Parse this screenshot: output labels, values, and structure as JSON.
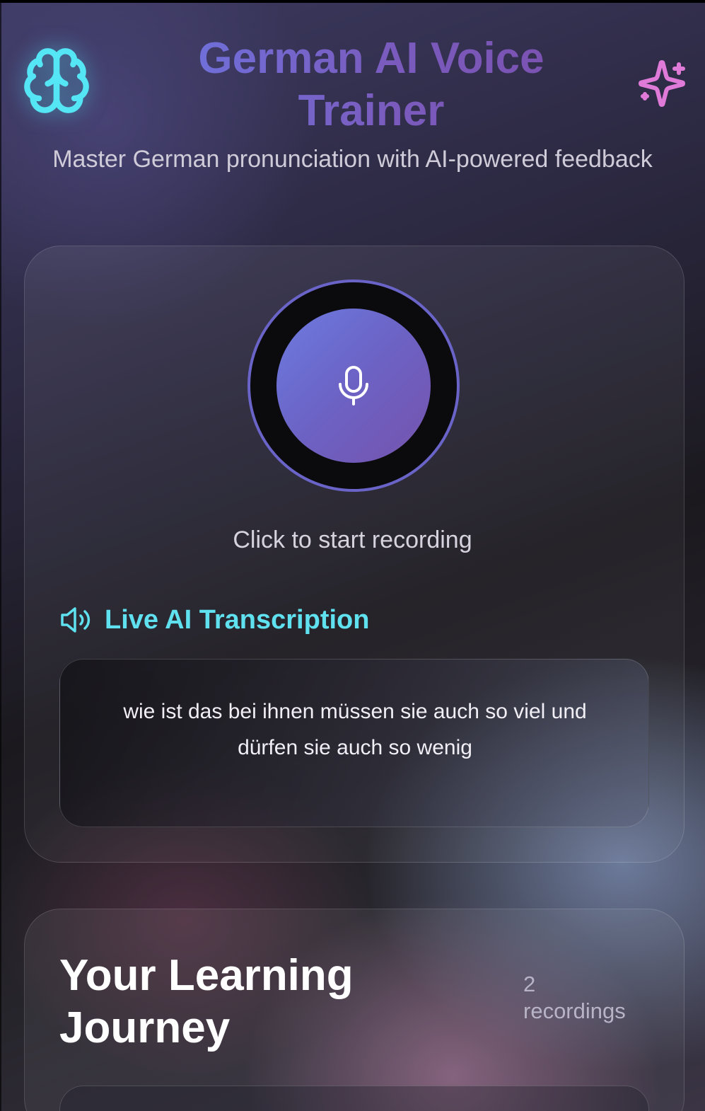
{
  "header": {
    "title": "German AI Voice Trainer",
    "subtitle": "Master German pronunciation with AI-powered feedback",
    "left_icon": "brain-icon",
    "right_icon": "sparkles-icon"
  },
  "recorder": {
    "icon": "microphone-icon",
    "hint": "Click to start recording"
  },
  "transcription": {
    "icon": "speaker-icon",
    "heading": "Live AI Transcription",
    "text": "wie ist das bei ihnen müssen sie auch so viel und dürfen sie auch so wenig"
  },
  "journey": {
    "title": "Your Learning Journey",
    "count_number": "2",
    "count_label": "recordings"
  },
  "colors": {
    "accent_cyan": "#5fe1ef",
    "accent_purple": "#6d74e0",
    "accent_pink": "#e07ad8"
  }
}
